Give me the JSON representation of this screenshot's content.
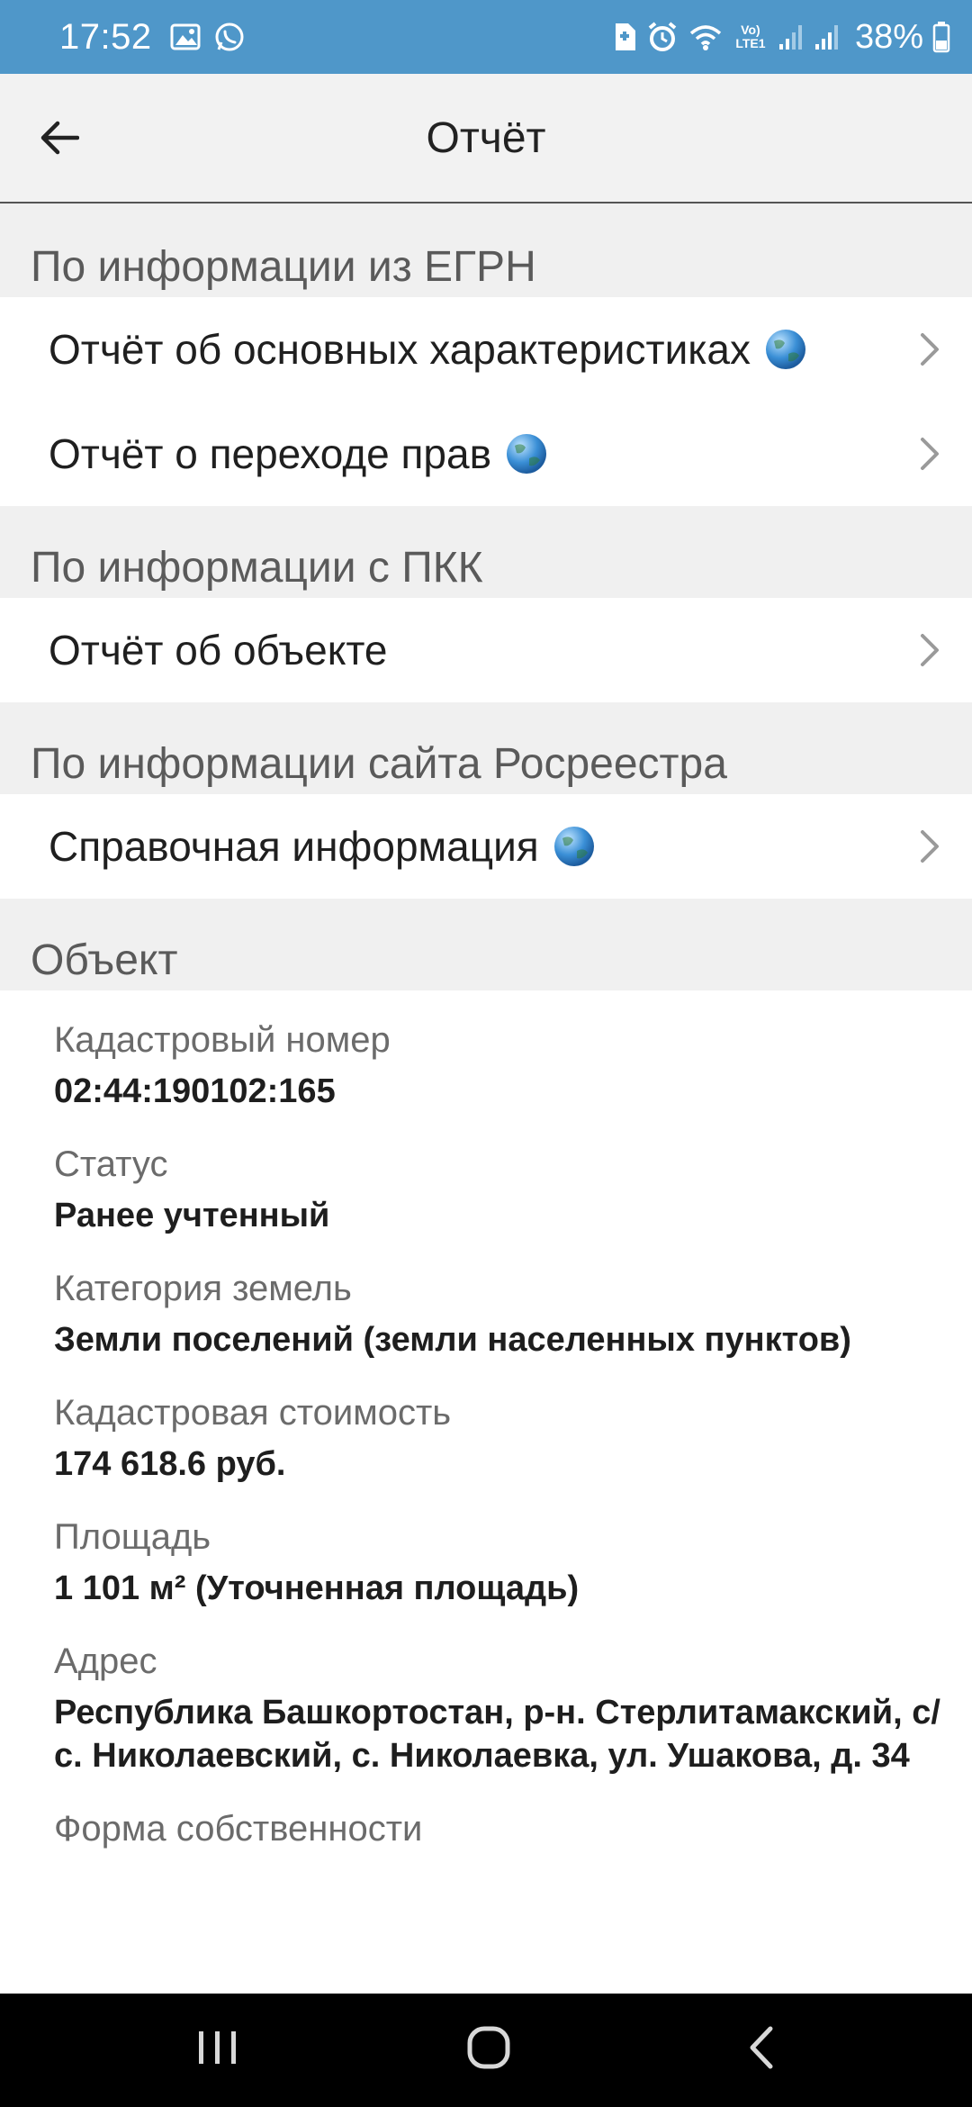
{
  "status_bar": {
    "time": "17:52",
    "battery": "38%",
    "network": "Vo) LTE1",
    "icons": [
      "gallery-icon",
      "whatsapp-icon",
      "sd-card-icon",
      "alarm-icon",
      "wifi-icon",
      "signal-icon",
      "battery-icon"
    ]
  },
  "app_bar": {
    "title": "Отчёт"
  },
  "sections": {
    "egrn": {
      "header": "По информации из ЕГРН",
      "items": [
        {
          "label": "Отчёт об основных характеристиках",
          "globe": true
        },
        {
          "label": "Отчёт о переходе прав",
          "globe": true
        }
      ]
    },
    "pkk": {
      "header": "По информации с ПКК",
      "items": [
        {
          "label": "Отчёт об объекте",
          "globe": false
        }
      ]
    },
    "rosreestr": {
      "header": "По информации сайта Росреестра",
      "items": [
        {
          "label": "Справочная информация",
          "globe": true
        }
      ]
    },
    "object": {
      "header": "Объект"
    }
  },
  "object_fields": [
    {
      "label": "Кадастровый номер",
      "value": "02:44:190102:165"
    },
    {
      "label": "Статус",
      "value": "Ранее учтенный"
    },
    {
      "label": "Категория земель",
      "value": "Земли поселений (земли населенных пунктов)"
    },
    {
      "label": "Кадастровая стоимость",
      "value": "174 618.6 руб."
    },
    {
      "label": "Площадь",
      "value": "1 101 м² (Уточненная площадь)"
    },
    {
      "label": "Адрес",
      "value": "Республика Башкортостан, р-н. Стерлитамакский, с/с. Николаевский, с. Николаевка, ул. Ушакова, д. 34"
    },
    {
      "label": "Форма собственности",
      "value": ""
    }
  ],
  "colors": {
    "status_bar": "#4f97c9",
    "app_bar": "#f2f2f2",
    "section_bg": "#f0f0f0",
    "globe": "#3a8fd6"
  }
}
